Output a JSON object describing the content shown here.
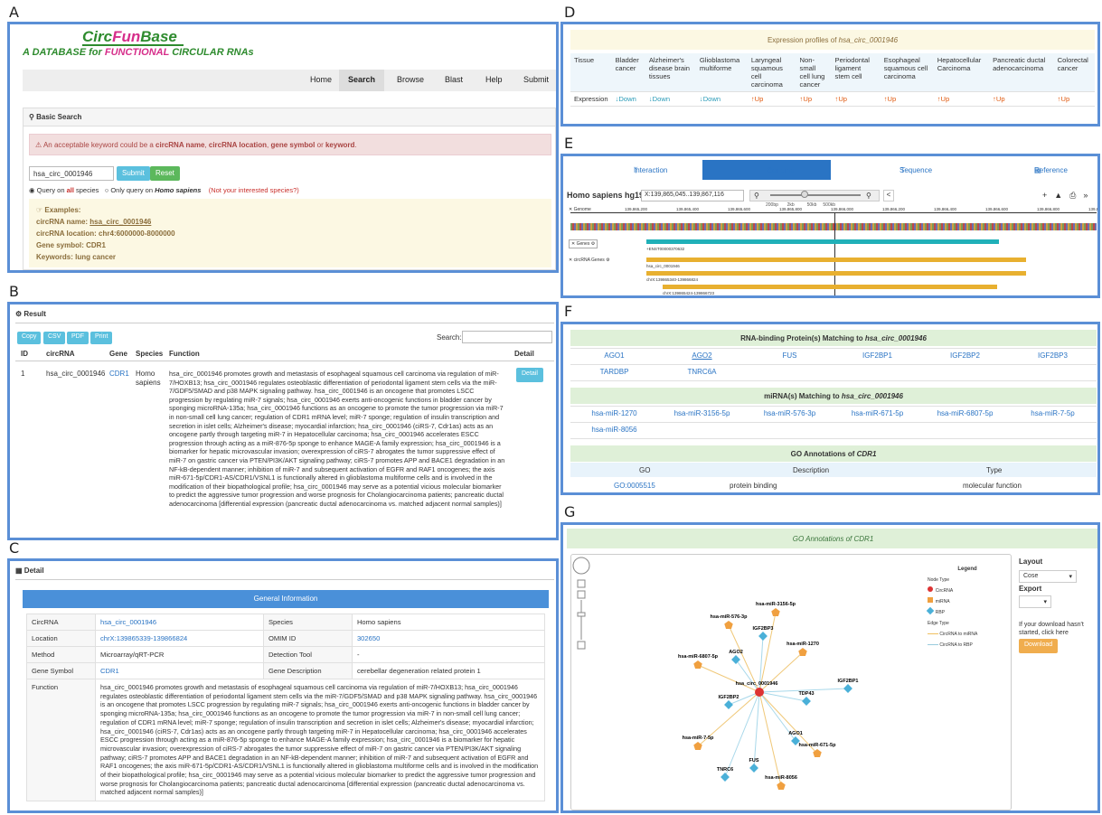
{
  "labels": {
    "a": "A",
    "b": "B",
    "c": "C",
    "d": "D",
    "e": "E",
    "f": "F",
    "g": "G"
  },
  "panelA": {
    "logo_pre": "Circ",
    "logo_mid": "Fun",
    "logo_post": "Base",
    "tag_pre": "A DATABASE for ",
    "tag_mid": "FUNCTIONAL",
    "tag_post": " CIRCULAR RNAs",
    "nav": [
      "Home",
      "Search",
      "Browse",
      "Blast",
      "Help",
      "Submit"
    ],
    "box_title": "Basic Search",
    "alert_pre": "An acceptable keyword could be a ",
    "alert_k1": "circRNA name",
    "alert_s1": ", ",
    "alert_k2": "circRNA location",
    "alert_s2": ", ",
    "alert_k3": "gene symbol",
    "alert_s3": " or ",
    "alert_k4": "keyword",
    "alert_end": ".",
    "search_value": "hsa_circ_0001946",
    "submit": "Submit",
    "reset": "Reset",
    "radio1_pre": "Query on ",
    "radio1_all": "all",
    "radio1_post": " species",
    "radio2_pre": "Only query on ",
    "radio2_sp": "Homo sapiens",
    "radio_note": "(Not your interested species?)",
    "examples_title": "Examples:",
    "ex_name_k": "circRNA name: ",
    "ex_name_v": "hsa_circ_0001946",
    "ex_loc_k": "circRNA location: ",
    "ex_loc_v": "chr4:6000000-8000000",
    "ex_gene_k": "Gene symbol: ",
    "ex_gene_v": "CDR1",
    "ex_kw_k": "Keywords: ",
    "ex_kw_v": "lung cancer"
  },
  "panelB": {
    "title": "Result",
    "buttons": [
      "Copy",
      "CSV",
      "PDF",
      "Print"
    ],
    "search_label": "Search:",
    "headers": [
      "ID",
      "circRNA",
      "Gene",
      "Species",
      "Function",
      "Detail"
    ],
    "row_id": "1",
    "row_circ": "hsa_circ_0001946",
    "row_gene": "CDR1",
    "row_sp1": "Homo",
    "row_sp2": "sapiens",
    "detail_btn": "Detail",
    "function": "hsa_circ_0001946 promotes growth and metastasis of esophageal squamous cell carcinoma via regulation of miR-7/HOXB13; hsa_circ_0001946 regulates osteoblastic differentiation of periodontal ligament stem cells via the miR-7/GDF5/SMAD and p38 MAPK signaling pathway. hsa_circ_0001946 is an oncogene that promotes LSCC progression by regulating miR-7 signals; hsa_circ_0001946 exerts anti-oncogenic functions in bladder cancer by sponging microRNA-135a; hsa_circ_0001946 functions as an oncogene to promote the tumor progression via miR-7 in non-small cell lung cancer; regulation of CDR1 mRNA level; miR-7 sponge; regulation of insulin transcription and secretion in islet cells; Alzheimer's disease; myocardial infarction; hsa_circ_0001946 (ciRS-7, Cdr1as) acts as an oncogene partly through targeting miR-7 in Hepatocellular carcinoma; hsa_circ_0001946 accelerates ESCC progression through acting as a miR-876-5p sponge to enhance MAGE-A family expression; hsa_circ_0001946 is a biomarker for hepatic microvascular invasion; overexpression of ciRS-7 abrogates the tumor suppressive effect of miR-7 on gastric cancer via PTEN/PI3K/AKT signaling pathway; ciRS-7 promotes APP and BACE1 degradation in an NF-kB-dependent manner; inhibition of miR-7 and subsequent activation of EGFR and RAF1 oncogenes; the axis miR-671-5p/CDR1-AS/CDR1/VSNL1 is functionally altered in glioblastoma multiforme cells and is involved in the modification of their biopathological profile; hsa_circ_0001946 may serve as a potential vicious molecular biomarker to predict the aggressive tumor progression and worse prognosis for Cholangiocarcinoma patients; pancreatic ductal adenocarcinoma [differential expression (pancreatic ductal adenocarcinoma vs. matched adjacent normal samples)]"
  },
  "panelC": {
    "title": "Detail",
    "general": "General Information",
    "k_circ": "CircRNA",
    "v_circ": "hsa_circ_0001946",
    "k_species": "Species",
    "v_species": "Homo sapiens",
    "k_loc": "Location",
    "v_loc": "chrX:139865339-139866824",
    "k_omim": "OMIM ID",
    "v_omim": "302650",
    "k_method": "Method",
    "v_method": "Microarray/qRT-PCR",
    "k_tool": "Detection Tool",
    "v_tool": "-",
    "k_gene": "Gene Symbol",
    "v_gene": "CDR1",
    "k_gdesc": "Gene Description",
    "v_gdesc": "cerebellar degeneration related protein 1",
    "k_func": "Function"
  },
  "panelD": {
    "title_pre": "Expression profiles of ",
    "title_id": "hsa_circ_0001946",
    "row1_label": "Tissue",
    "row2_label": "Expression",
    "tissues": [
      "Bladder cancer",
      "Alzheimer's disease brain tissues",
      "Glioblastoma multiforme",
      "Laryngeal squamous cell carcinoma",
      "Non-small cell lung cancer",
      "Periodontal ligament stem cell",
      "Esophageal squamous cell carcinoma",
      "Hepatocellular Carcinoma",
      "Pancreatic ductal adenocarcinoma",
      "Colorectal cancer"
    ],
    "expr": [
      "↓Down",
      "↓Down",
      "↓Down",
      "↑Up",
      "↑Up",
      "↑Up",
      "↑Up",
      "↑Up",
      "↑Up",
      "↑Up"
    ]
  },
  "panelE": {
    "tabs": [
      "Interaction",
      "Genome",
      "Sequence",
      "Reference"
    ],
    "species": "Homo sapiens hg19",
    "locus": "X:139,865,045..139,867,116",
    "scale": [
      "200bp",
      "2kb",
      "50kb",
      "500kb"
    ],
    "ruler": [
      "139,865,200",
      "139,865,400",
      "139,865,600",
      "139,865,800",
      "139,866,000",
      "139,866,200",
      "139,866,400",
      "139,866,600",
      "139,866,800",
      "139,867,000"
    ],
    "genome_label": "Genome",
    "genes_label": "Genes",
    "circ_genes_label": "circRNA Genes",
    "gene_name": "+ENST00000370632",
    "circ1": "hsa_circ_0001946",
    "circ2": "chrX:139865340-139866824",
    "circ3": "chrX:139865424-139866723"
  },
  "panelF": {
    "rbp_title_pre": "RNA-binding Protein(s) Matching to ",
    "rbp_title_id": "hsa_circ_0001946",
    "rbp": [
      "AGO1",
      "AGO2",
      "FUS",
      "IGF2BP1",
      "IGF2BP2",
      "IGF2BP3",
      "TARDBP",
      "TNRC6A"
    ],
    "mir_title_pre": "miRNA(s) Matching to ",
    "mir_title_id": "hsa_circ_0001946",
    "mir": [
      "hsa-miR-1270",
      "hsa-miR-3156-5p",
      "hsa-miR-576-3p",
      "hsa-miR-671-5p",
      "hsa-miR-6807-5p",
      "hsa-miR-7-5p",
      "hsa-miR-8056"
    ],
    "go_title_pre": "GO Annotations of ",
    "go_title_id": "CDR1",
    "go_headers": [
      "GO",
      "Description",
      "Type"
    ],
    "go_row": [
      "GO:0005515",
      "protein binding",
      "molecular function"
    ]
  },
  "panelG": {
    "title_pre": "GO Annotations of ",
    "title_id": "CDR1",
    "legend_title": "Legend",
    "node_type": "Node Type",
    "nodes": [
      "CircRNA",
      "miRNA",
      "RBP"
    ],
    "edge_type": "Edge Type",
    "edges": [
      "CircRNA to miRNA",
      "CircRNA to RBP"
    ],
    "layout_label": "Layout",
    "layout_value": "Cose",
    "export_label": "Export",
    "download_note": "If your download hasn't started, click here",
    "download_btn": "Download",
    "center": "hsa_circ_0001946",
    "mirna_nodes": [
      "hsa-miR-3156-5p",
      "hsa-miR-576-3p",
      "hsa-miR-1270",
      "hsa-miR-6807-5p",
      "hsa-miR-7-5p",
      "hsa-miR-671-5p",
      "hsa-miR-8056"
    ],
    "rbp_nodes": [
      "IGF2BP3",
      "AGO2",
      "IGF2BP1",
      "IGF2BP2",
      "TDP43",
      "AGO1",
      "FUS",
      "TNRC6"
    ],
    "colors": {
      "circ": "#d33",
      "mirna": "#f0a040",
      "rbp": "#4ab0d8"
    }
  }
}
